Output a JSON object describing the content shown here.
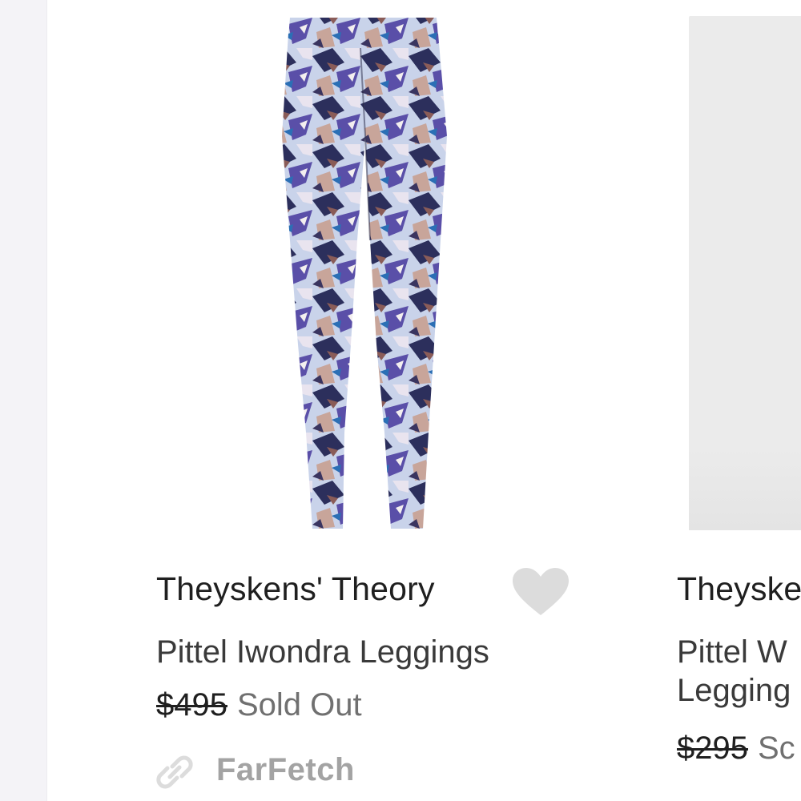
{
  "products": [
    {
      "brand": "Theyskens' Theory",
      "name": "Pittel Iwondra Leggings",
      "price": "$495",
      "status": "Sold Out",
      "source": "FarFetch",
      "image": "printed-leggings-photo",
      "favorite_icon": "heart-icon",
      "source_icon": "link-icon"
    },
    {
      "brand": "Theyske",
      "name_lines": [
        "Pittel W",
        "Legging"
      ],
      "price": "$295",
      "status": "Sc",
      "image": "product-photo-placeholder"
    }
  ],
  "colors": {
    "brand_text": "#1f1f1f",
    "name_text": "#3a3a3a",
    "muted_text": "#707070",
    "source_text": "#a3a3a3",
    "heart": "#dcdcdc",
    "gutter": "#f4f3f7"
  }
}
